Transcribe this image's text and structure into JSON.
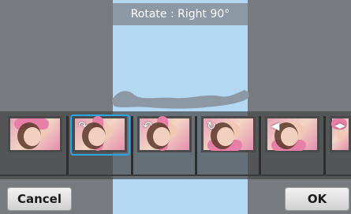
{
  "header": {
    "title": "Rotate : Right 90°"
  },
  "filmstrip": {
    "items": [
      {
        "name": "original"
      },
      {
        "name": "rotate-right-90",
        "icon": "rotate-right-icon",
        "icon_glyph": "↷",
        "selected": true
      },
      {
        "name": "rotate-left-90",
        "icon": "rotate-left-icon",
        "icon_glyph": "↶"
      },
      {
        "name": "rotate-180",
        "icon": "rotate-180-icon",
        "icon_glyph": "↻"
      },
      {
        "name": "flip-vertical",
        "icon": "flip-vertical-icon",
        "icon_glyph": "◀"
      },
      {
        "name": "flip-horizontal",
        "icon": "flip-horizontal-icon",
        "icon_glyph": "◀▶"
      }
    ]
  },
  "buttons": {
    "cancel": "Cancel",
    "ok": "OK"
  },
  "colors": {
    "selection": "#2ba5e5",
    "center_panel": "#b5d8f2",
    "side_panel": "#777b7f"
  }
}
